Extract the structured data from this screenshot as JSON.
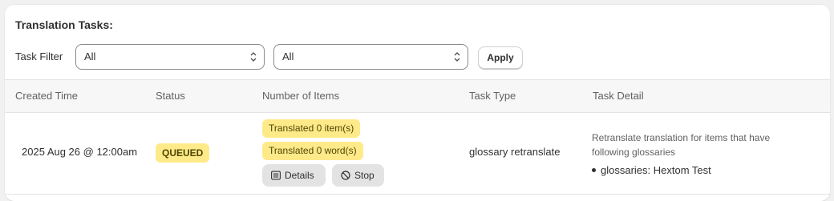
{
  "header": {
    "title": "Translation Tasks:"
  },
  "filter": {
    "label": "Task Filter",
    "select_1_value": "All",
    "select_2_value": "All",
    "apply_label": "Apply"
  },
  "table": {
    "columns": [
      "Created Time",
      "Status",
      "Number of Items",
      "Task Type",
      "Task Detail"
    ],
    "rows": [
      {
        "created_time": "2025 Aug 26 @ 12:00am",
        "status": "QUEUED",
        "items_translated": "Translated 0 item(s)",
        "words_translated": "Translated 0 word(s)",
        "details_label": "Details",
        "stop_label": "Stop",
        "task_type": "glossary retranslate",
        "detail_description": "Retranslate translation for items that have following glossaries",
        "detail_items": [
          "glossaries: Hextom Test"
        ]
      }
    ]
  },
  "colors": {
    "status_badge_bg": "#ffea8a",
    "button_bg": "#e3e3e3",
    "header_bg": "#f7f7f7"
  },
  "icons": {
    "select_chevron": "chevron-up-down-icon",
    "details": "list-icon",
    "stop": "stop-circle-icon"
  }
}
